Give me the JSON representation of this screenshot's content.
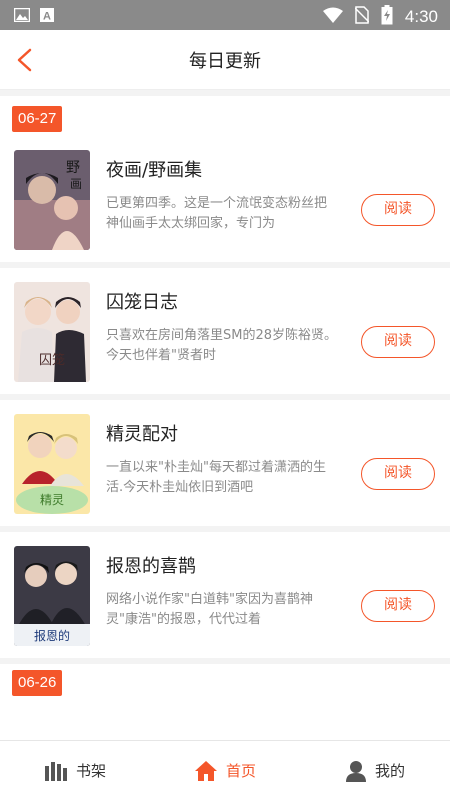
{
  "status_bar": {
    "time": "4:30"
  },
  "header": {
    "title": "每日更新"
  },
  "colors": {
    "accent": "#f4562a",
    "status_bar": "#8a8a8a",
    "desc_text": "#8a8a8a"
  },
  "sections": [
    {
      "date": "06-27",
      "items": [
        {
          "title": "夜画/野画集",
          "desc": "已更第四季。这是一个流氓变态粉丝把神仙画手太太绑回家，专门为",
          "button": "阅读"
        },
        {
          "title": "囚笼日志",
          "desc": "只喜欢在房间角落里SM的28岁陈裕贤。 今天也伴着\"贤者时",
          "button": "阅读"
        },
        {
          "title": "精灵配对",
          "desc": "一直以来\"朴圭灿\"每天都过着潇洒的生活.今天朴圭灿依旧到酒吧",
          "button": "阅读"
        },
        {
          "title": "报恩的喜鹊",
          "desc": "网络小说作家\"白道韩\"家因为喜鹊神灵\"康浩\"的报恩，代代过着",
          "button": "阅读"
        }
      ]
    },
    {
      "date": "06-26",
      "items": []
    }
  ],
  "bottom_nav": [
    {
      "label": "书架",
      "icon": "bookshelf-icon"
    },
    {
      "label": "首页",
      "icon": "home-icon"
    },
    {
      "label": "我的",
      "icon": "profile-icon"
    }
  ]
}
